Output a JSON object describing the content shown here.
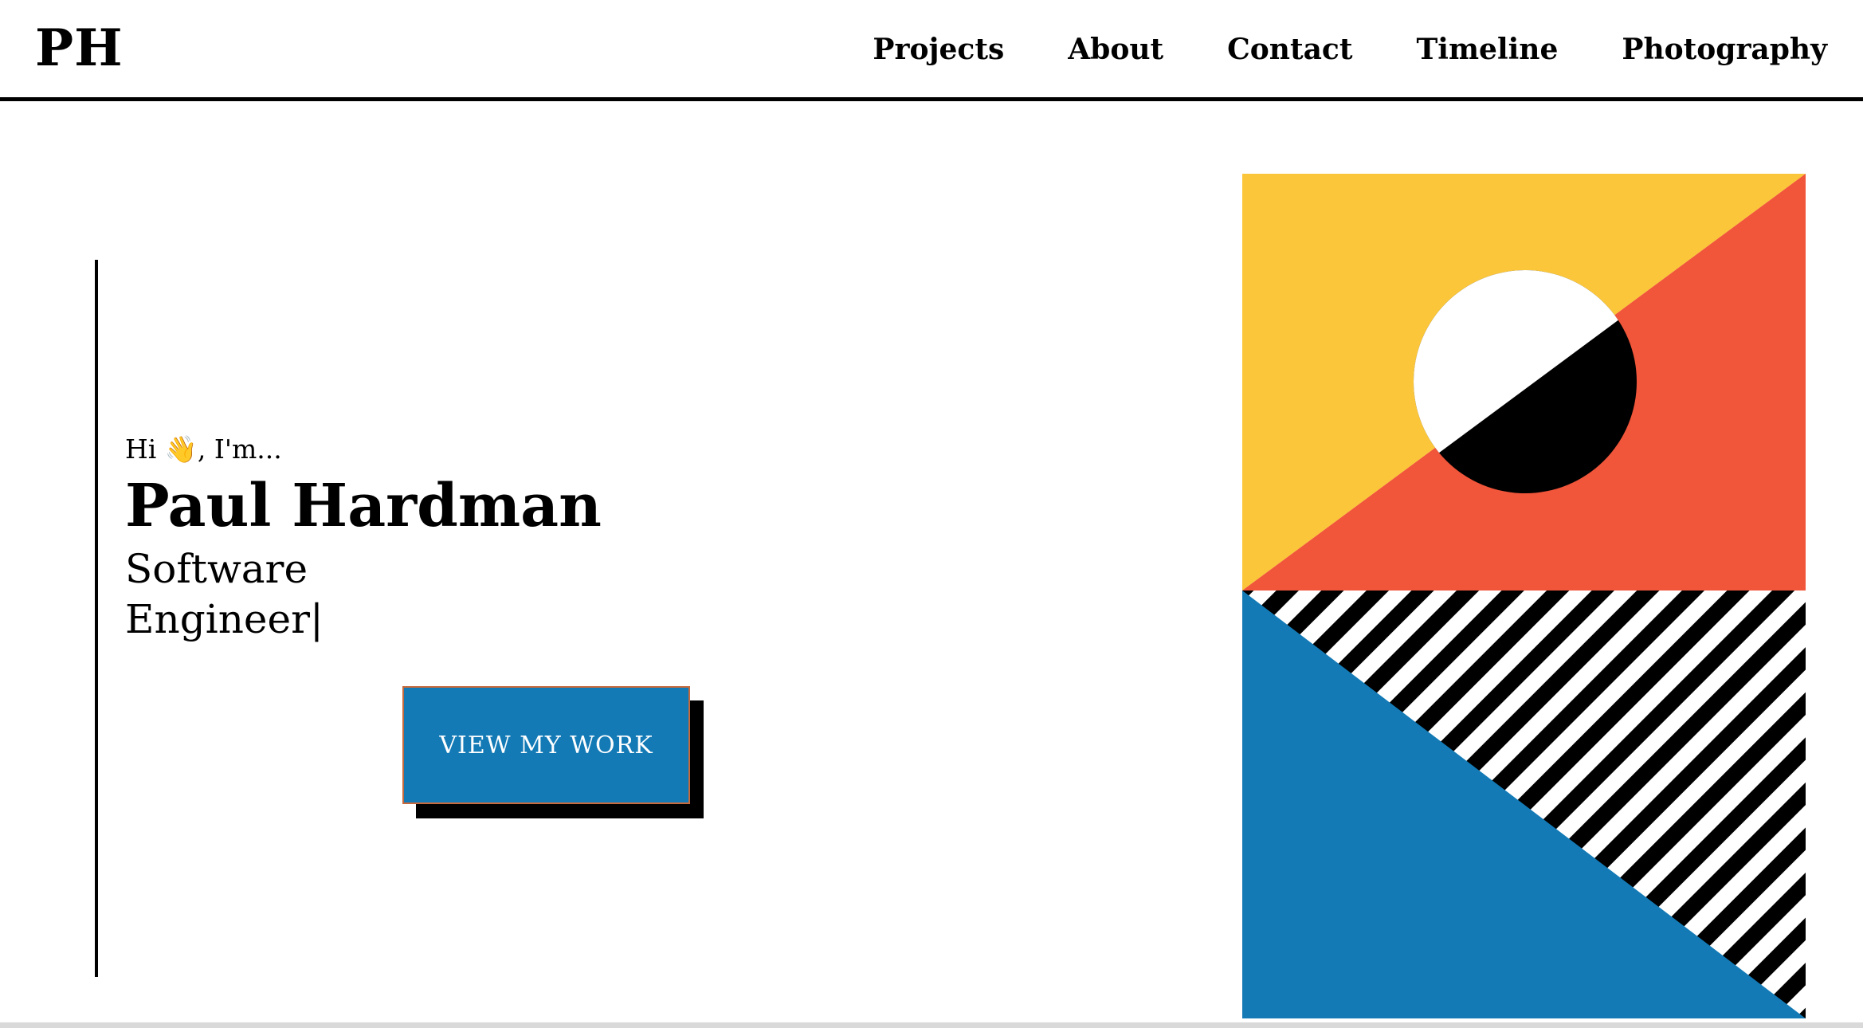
{
  "header": {
    "logo": "PH",
    "nav": [
      "Projects",
      "About",
      "Contact",
      "Timeline",
      "Photography"
    ]
  },
  "hero": {
    "greeting": "Hi 👋, I'm...",
    "name": "Paul Hardman",
    "role_line1": "Software",
    "role_line2": "Engineer",
    "cursor": "|",
    "button_label": "VIEW MY WORK"
  },
  "colors": {
    "yellow": "#fbc63a",
    "red": "#f1553a",
    "blue": "#137ab6",
    "black": "#000000",
    "white": "#ffffff"
  }
}
